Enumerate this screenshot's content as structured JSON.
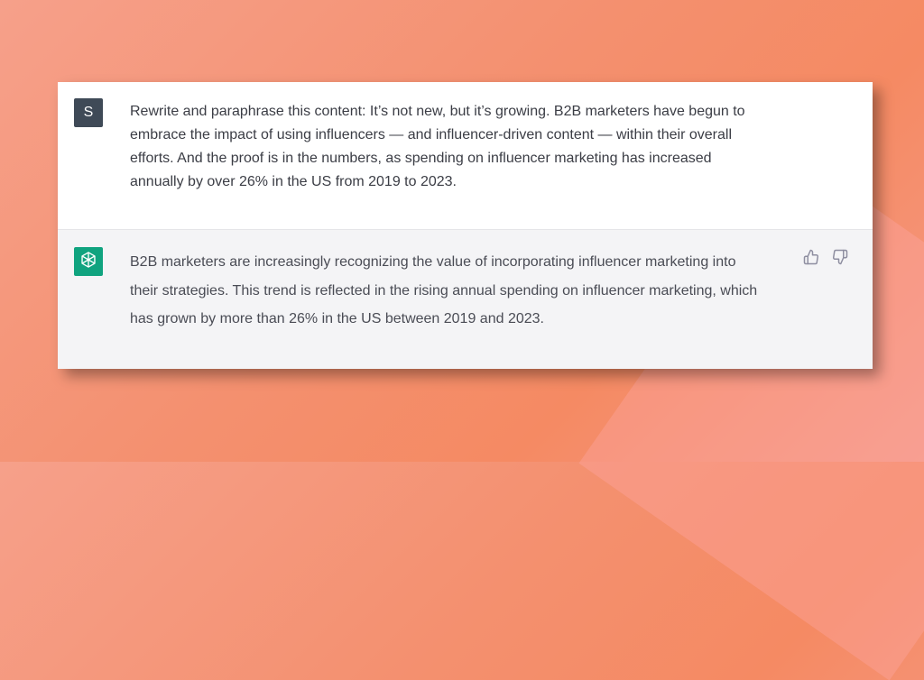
{
  "conversation": {
    "user_message": {
      "avatar_initial": "S",
      "text": "Rewrite and paraphrase this content: It’s not new, but it’s growing. B2B marketers have begun to embrace the impact of using influencers — and influencer-driven content — within their overall efforts. And the proof is in the numbers, as spending on influencer marketing has increased annually by over 26% in the US from 2019 to 2023."
    },
    "assistant_message": {
      "avatar_icon": "openai-logo-icon",
      "text": "B2B marketers are increasingly recognizing the value of incorporating influencer marketing into their strategies. This trend is reflected in the rising annual spending on influencer marketing, which has grown by more than 26% in the US between 2019 and 2023.",
      "feedback": {
        "thumbs_up_icon": "thumbs-up-icon",
        "thumbs_down_icon": "thumbs-down-icon"
      }
    }
  },
  "colors": {
    "user_avatar_bg": "#3f4a57",
    "assistant_avatar_bg": "#10a37f",
    "assistant_row_bg": "#f4f4f6",
    "background_gradient_start": "#f6a08a",
    "background_gradient_end": "#f58a63"
  }
}
